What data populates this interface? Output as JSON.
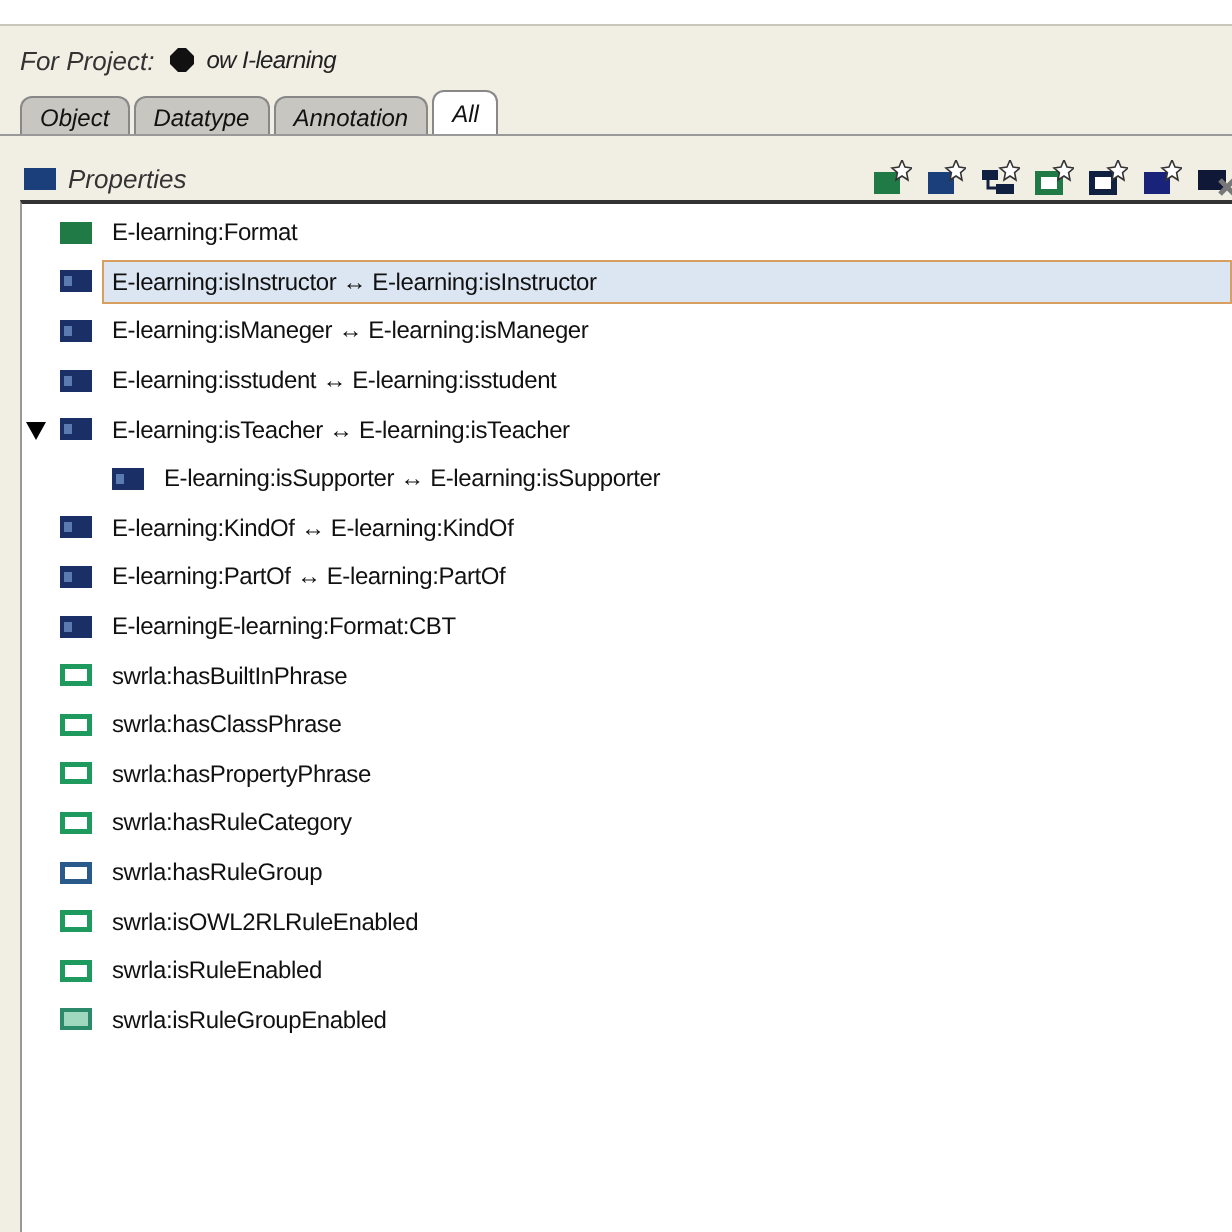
{
  "project": {
    "label": "For Project:",
    "name": "ow I-learning"
  },
  "tabs": [
    {
      "label": "Object",
      "selected": false
    },
    {
      "label": "Datatype",
      "selected": false
    },
    {
      "label": "Annotation",
      "selected": false
    },
    {
      "label": "All",
      "selected": true
    }
  ],
  "panel": {
    "title": "Properties"
  },
  "properties": [
    {
      "label": "E-learning:Format",
      "kind": "solid",
      "color": "#1f7a45",
      "selected": false
    },
    {
      "label": "E-learning:isInstructor ↔ E-learning:isInstructor",
      "kind": "striped",
      "color": "#1a2f66",
      "selected": true
    },
    {
      "label": "E-learning:isManeger ↔ E-learning:isManeger",
      "kind": "striped",
      "color": "#1a2f66",
      "selected": false
    },
    {
      "label": "E-learning:isstudent ↔ E-learning:isstudent",
      "kind": "striped",
      "color": "#1a2f66",
      "selected": false
    },
    {
      "label": "E-learning:isTeacher ↔ E-learning:isTeacher",
      "kind": "striped",
      "color": "#1a2f66",
      "selected": false,
      "expanded": true,
      "children": [
        {
          "label": "E-learning:isSupporter ↔ E-learning:isSupporter",
          "kind": "striped",
          "color": "#1a2f66",
          "selected": false
        }
      ]
    },
    {
      "label": "E-learning:KindOf ↔ E-learning:KindOf",
      "kind": "striped",
      "color": "#1a2f66",
      "selected": false
    },
    {
      "label": "E-learning:PartOf ↔ E-learning:PartOf",
      "kind": "striped",
      "color": "#1a2f66",
      "selected": false
    },
    {
      "label": "E-learningE-learning:Format:CBT",
      "kind": "striped",
      "color": "#1a2f66",
      "selected": false
    },
    {
      "label": "swrla:hasBuiltInPhrase",
      "kind": "frame",
      "color": "#1f9a5e",
      "selected": false
    },
    {
      "label": "swrla:hasClassPhrase",
      "kind": "frame",
      "color": "#1f9a5e",
      "selected": false
    },
    {
      "label": "swrla:hasPropertyPhrase",
      "kind": "frame",
      "color": "#1f9a5e",
      "selected": false
    },
    {
      "label": "swrla:hasRuleCategory",
      "kind": "frame",
      "color": "#1f9a5e",
      "selected": false
    },
    {
      "label": "swrla:hasRuleGroup",
      "kind": "frame",
      "color": "#2a5a8a",
      "selected": false
    },
    {
      "label": "swrla:isOWL2RLRuleEnabled",
      "kind": "frame",
      "color": "#1f9a5e",
      "selected": false
    },
    {
      "label": "swrla:isRuleEnabled",
      "kind": "frame",
      "color": "#1f9a5e",
      "selected": false
    },
    {
      "label": "swrla:isRuleGroupEnabled",
      "kind": "tinted",
      "color": "#2a8a6a",
      "selected": false
    }
  ]
}
